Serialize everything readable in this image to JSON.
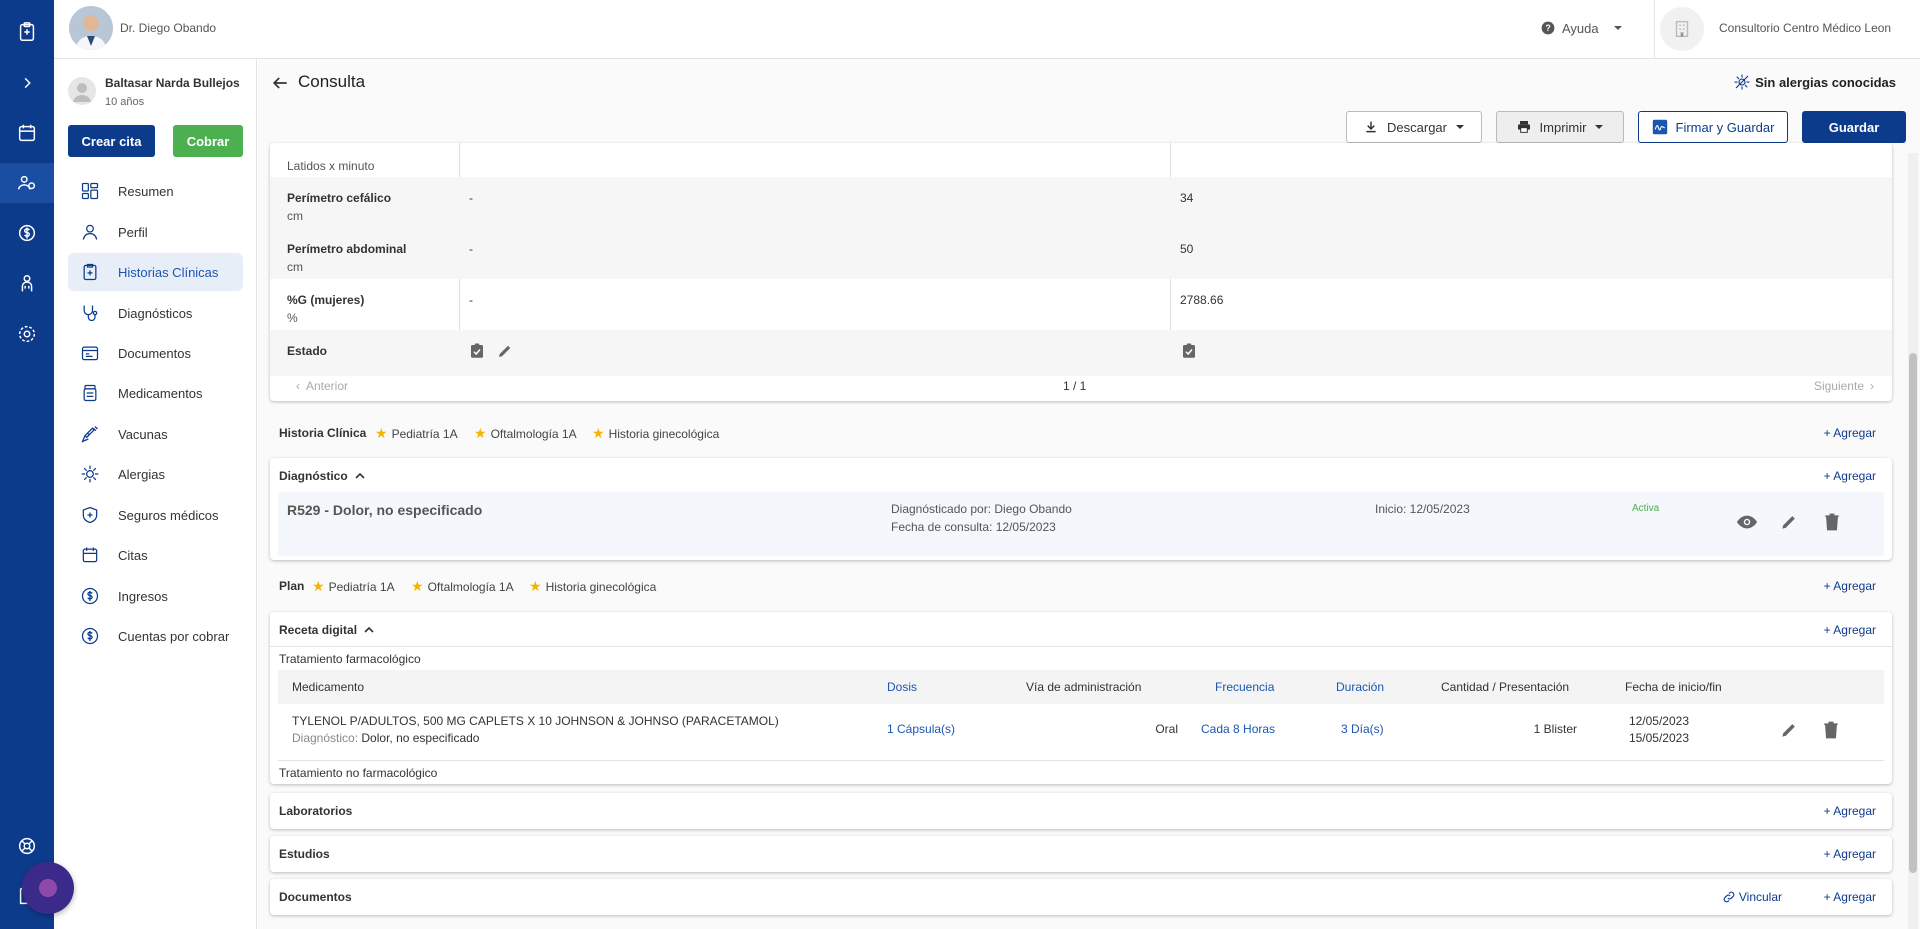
{
  "header": {
    "doctor_name": "Dr. Diego Obando",
    "help_label": "Ayuda",
    "clinic_name": "Consultorio Centro Médico Leon"
  },
  "patient": {
    "name": "Baltasar Narda Bullejos",
    "age": "10 años",
    "btn_cita": "Crear cita",
    "btn_cobrar": "Cobrar"
  },
  "nav": [
    {
      "label": "Resumen",
      "icon": "summary-icon"
    },
    {
      "label": "Perfil",
      "icon": "profile-icon"
    },
    {
      "label": "Historias Clínicas",
      "icon": "clinical-history-icon",
      "active": true
    },
    {
      "label": "Diagnósticos",
      "icon": "stethoscope-icon"
    },
    {
      "label": "Documentos",
      "icon": "documents-icon"
    },
    {
      "label": "Medicamentos",
      "icon": "medication-icon"
    },
    {
      "label": "Vacunas",
      "icon": "vaccine-icon"
    },
    {
      "label": "Alergias",
      "icon": "allergy-icon"
    },
    {
      "label": "Seguros médicos",
      "icon": "insurance-icon"
    },
    {
      "label": "Citas",
      "icon": "calendar-icon"
    },
    {
      "label": "Ingresos",
      "icon": "income-icon"
    },
    {
      "label": "Cuentas por cobrar",
      "icon": "receivables-icon"
    }
  ],
  "page": {
    "title": "Consulta",
    "allergy_text": "Sin alergias conocidas",
    "btn_download": "Descargar",
    "btn_print": "Imprimir",
    "btn_sign": "Firmar y Guardar",
    "btn_save": "Guardar"
  },
  "vitals": {
    "rows": [
      {
        "label": "Latidos x minuto",
        "unit": "",
        "v1": "",
        "v2": ""
      },
      {
        "label": "Perímetro cefálico",
        "unit": "cm",
        "v1": "-",
        "v2": "34"
      },
      {
        "label": "Perímetro abdominal",
        "unit": "cm",
        "v1": "-",
        "v2": "50"
      },
      {
        "label": "%G (mujeres)",
        "unit": "%",
        "v1": "-",
        "v2": "2788.66"
      },
      {
        "label": "Estado",
        "unit": "",
        "v1": "",
        "v2": ""
      }
    ],
    "prev": "Anterior",
    "next": "Siguiente",
    "page": "1 / 1"
  },
  "history": {
    "title": "Historia Clínica",
    "tags": [
      "Pediatría 1A",
      "Oftalmología 1A",
      "Historia ginecológica"
    ],
    "add": "+ Agregar"
  },
  "diagnosis": {
    "title": "Diagnóstico",
    "add": "+ Agregar",
    "code": "R529 - Dolor, no especificado",
    "by": "Diagnósticado por: Diego Obando",
    "date": "Fecha de consulta: 12/05/2023",
    "start": "Inicio: 12/05/2023",
    "status": "Activa"
  },
  "plan": {
    "title": "Plan",
    "tags": [
      "Pediatría 1A",
      "Oftalmología 1A",
      "Historia ginecológica"
    ],
    "add": "+ Agregar"
  },
  "prescription": {
    "title": "Receta digital",
    "add": "+ Agregar",
    "pharma_title": "Tratamiento farmacológico",
    "nonpharma_title": "Tratamiento no farmacológico",
    "headers": [
      "Medicamento",
      "Dosis",
      "Vía de administración",
      "Frecuencia",
      "Duración",
      "Cantidad / Presentación",
      "Fecha de inicio/fin"
    ],
    "row": {
      "med": "TYLENOL P/ADULTOS, 500 MG CAPLETS X 10 JOHNSON & JOHNSO (PARACETAMOL)",
      "diag_label": "Diagnóstico:",
      "diag_value": "Dolor, no especificado",
      "dose": "1 Cápsula(s)",
      "route": "Oral",
      "freq": "Cada 8 Horas",
      "duration": "3 Día(s)",
      "qty": "1 Blister",
      "date_start": "12/05/2023",
      "date_end": "15/05/2023"
    }
  },
  "labs": {
    "title": "Laboratorios",
    "add": "+ Agregar"
  },
  "studies": {
    "title": "Estudios",
    "add": "+ Agregar"
  },
  "documents": {
    "title": "Documentos",
    "link": "Vincular",
    "add": "+ Agregar"
  },
  "colors": {
    "primary": "#0d3b8c",
    "success": "#4caf50",
    "star": "#f4b400",
    "status_active": "#4caf50"
  }
}
